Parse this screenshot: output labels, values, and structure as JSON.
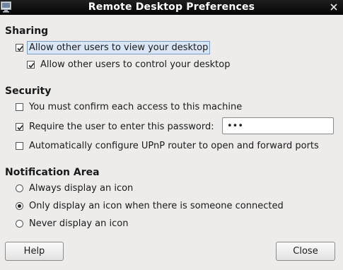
{
  "window": {
    "title": "Remote Desktop Preferences"
  },
  "sharing": {
    "heading": "Sharing",
    "allow_view": {
      "label": "Allow other users to view your desktop",
      "checked": true
    },
    "allow_control": {
      "label": "Allow other users to control your desktop",
      "checked": true
    }
  },
  "security": {
    "heading": "Security",
    "confirm_access": {
      "label": "You must confirm each access to this machine",
      "checked": false
    },
    "require_password": {
      "label": "Require the user to enter this password:",
      "checked": true,
      "password_value": "•••"
    },
    "upnp": {
      "label": "Automatically configure UPnP router to open and forward ports",
      "checked": false
    }
  },
  "notification": {
    "heading": "Notification Area",
    "options": [
      {
        "label": "Always display an icon",
        "selected": false
      },
      {
        "label": "Only display an icon when there is someone connected",
        "selected": true
      },
      {
        "label": "Never display an icon",
        "selected": false
      }
    ]
  },
  "buttons": {
    "help": "Help",
    "close": "Close"
  }
}
